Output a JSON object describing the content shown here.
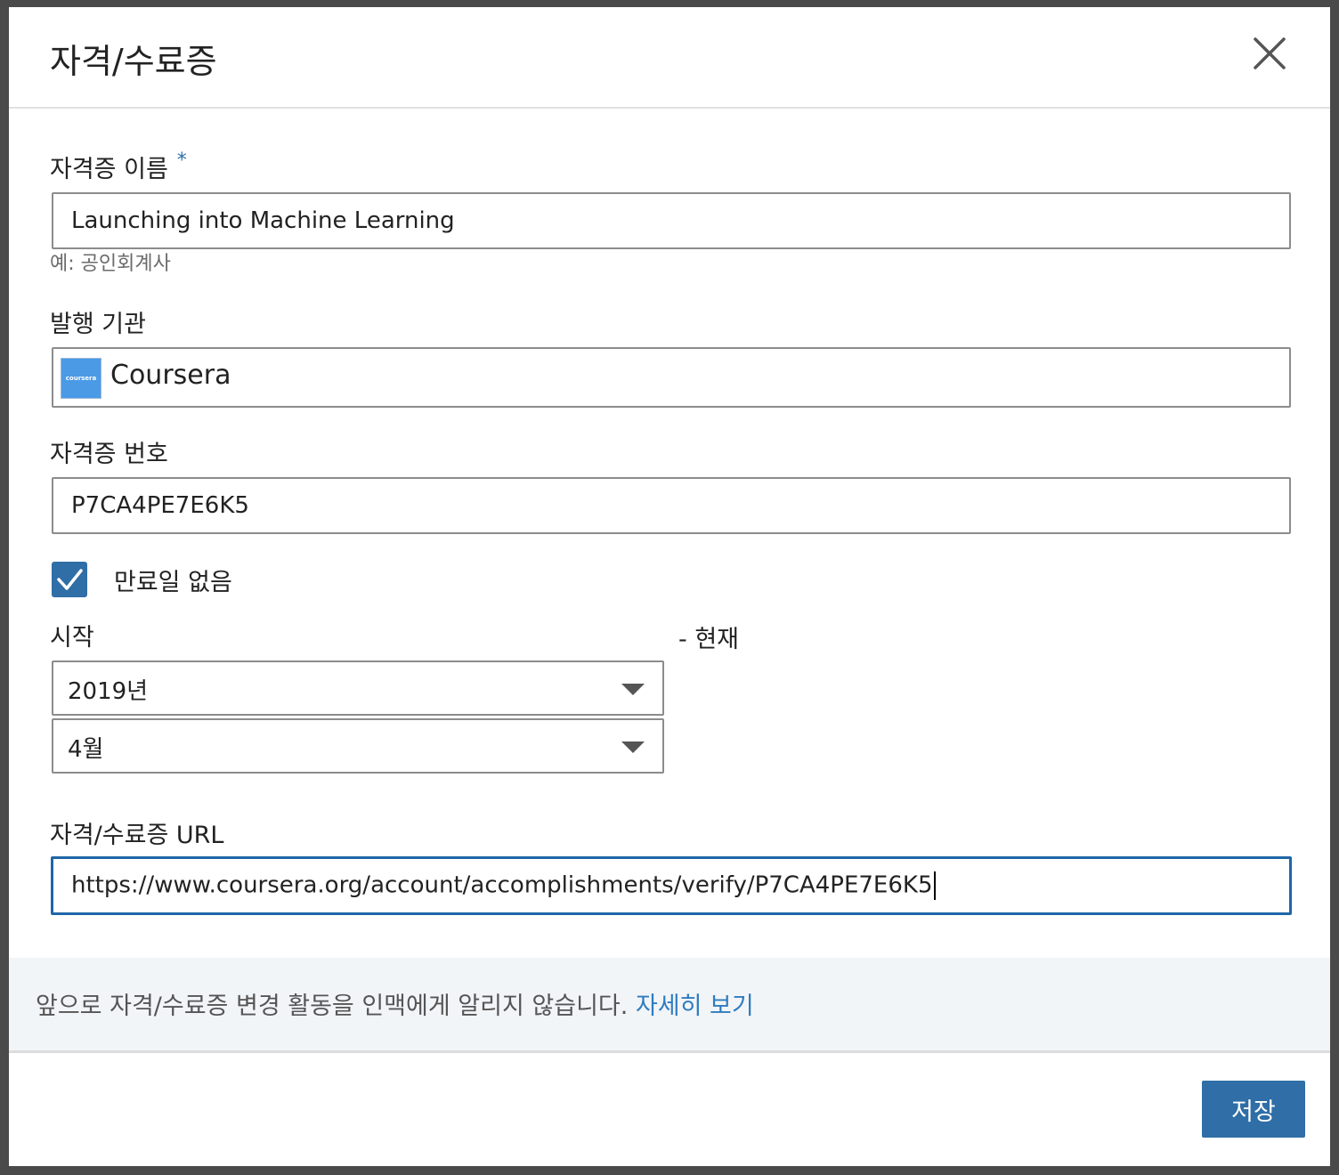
{
  "dialog": {
    "title": "자격/수료증"
  },
  "icons": {
    "close": "close-icon",
    "check": "checkmark-icon",
    "caret": "chevron-down-icon",
    "issuer_logo": "coursera-logo"
  },
  "form": {
    "name_label": "자격증 이름",
    "required_marker": "*",
    "name_value": "Launching into Machine Learning",
    "name_helper": "예: 공인회계사",
    "issuer_label": "발행 기관",
    "issuer_value": "Coursera",
    "issuer_logo_text": "coursera",
    "credential_id_label": "자격증 번호",
    "credential_id_value": "P7CA4PE7E6K5",
    "no_expiry_label": "만료일 없음",
    "no_expiry_checked": true,
    "start_label": "시작",
    "start_year": "2019년",
    "start_month": "4월",
    "end_label": "- 현재",
    "url_label": "자격/수료증 URL",
    "url_value": "https://www.coursera.org/account/accomplishments/verify/P7CA4PE7E6K5"
  },
  "footer": {
    "notice": "앞으로 자격/수료증 변경 활동을 인맥에게 알리지 않습니다.",
    "learn_more": "자세히 보기",
    "save_label": "저장"
  },
  "colors": {
    "primary": "#2f6ea6",
    "link": "#2f7bbf",
    "focus_border": "#1f66a8",
    "footer_bg": "#f2f5f8"
  }
}
